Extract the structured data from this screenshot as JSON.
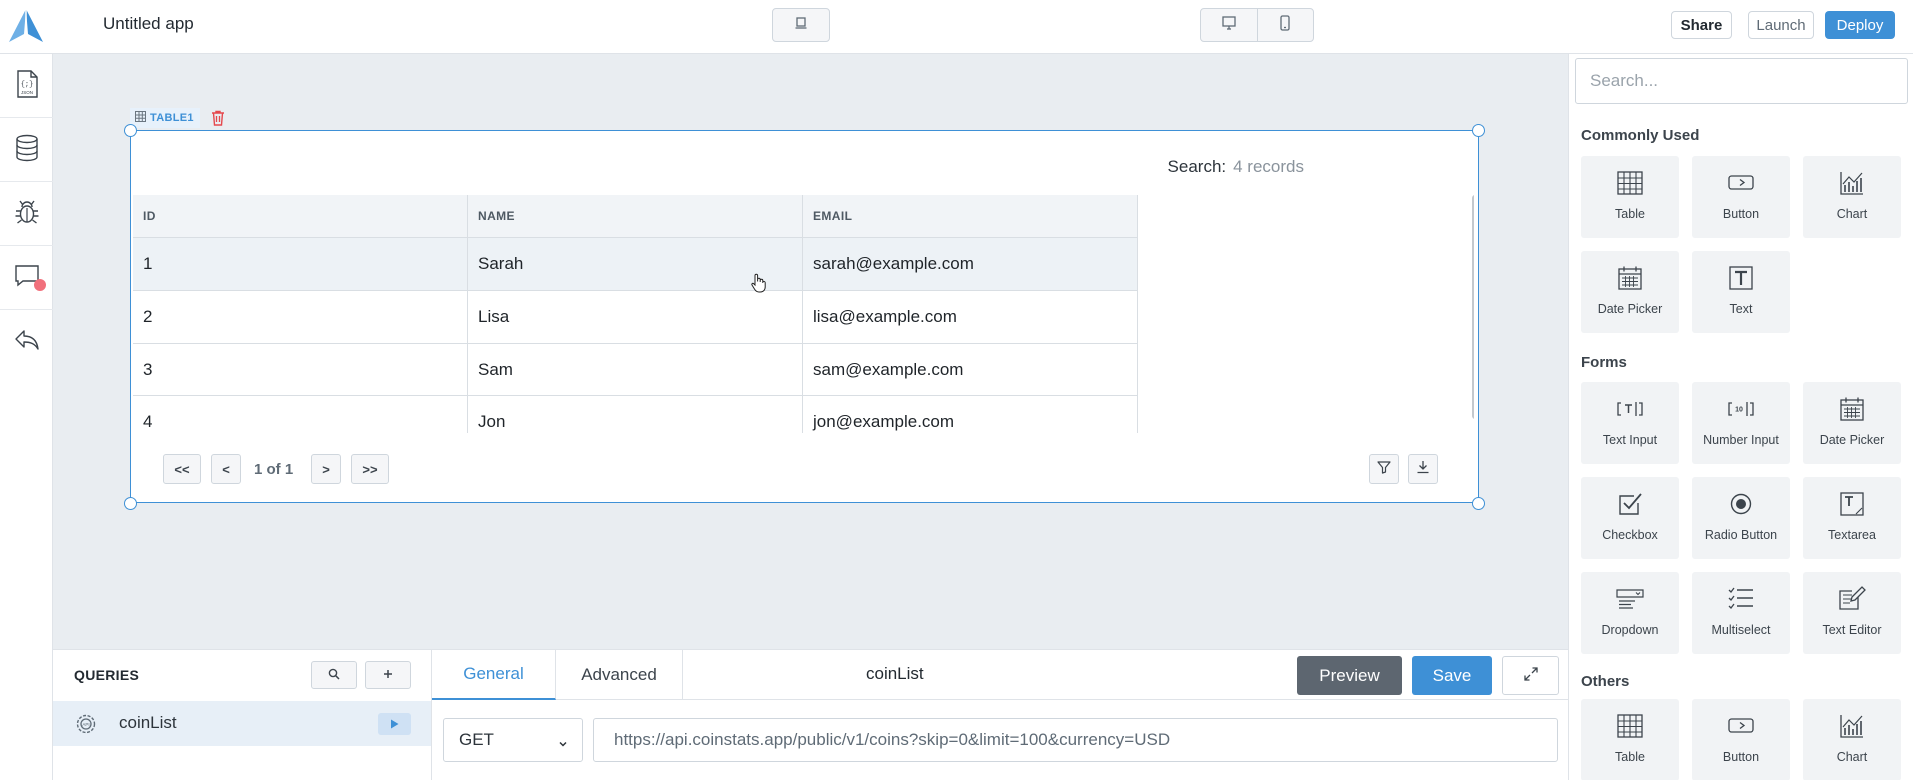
{
  "header": {
    "app_title": "Untitled app",
    "share_label": "Share",
    "launch_label": "Launch",
    "deploy_label": "Deploy"
  },
  "canvas": {
    "table_tag": "TABLE1",
    "search_label": "Search:",
    "search_value": "4 records",
    "columns": [
      "ID",
      "NAME",
      "EMAIL"
    ],
    "rows": [
      [
        "1",
        "Sarah",
        "sarah@example.com"
      ],
      [
        "2",
        "Lisa",
        "lisa@example.com"
      ],
      [
        "3",
        "Sam",
        "sam@example.com"
      ],
      [
        "4",
        "Jon",
        "jon@example.com"
      ]
    ],
    "pager": {
      "first": "<<",
      "prev": "<",
      "page_text": "1 of 1",
      "next": ">",
      "last": ">>"
    }
  },
  "queries": {
    "title": "QUERIES",
    "items": [
      {
        "label": "coinList"
      }
    ],
    "tabs": [
      "General",
      "Advanced"
    ],
    "active_tab": "General",
    "query_name": "coinList",
    "preview_label": "Preview",
    "save_label": "Save",
    "method": "GET",
    "url": "https://api.coinstats.app/public/v1/coins?skip=0&limit=100&currency=USD"
  },
  "widgets": {
    "search_placeholder": "Search...",
    "sections": [
      {
        "title": "Commonly Used",
        "items": [
          "Table",
          "Button",
          "Chart",
          "Date Picker",
          "Text"
        ]
      },
      {
        "title": "Forms",
        "items": [
          "Text Input",
          "Number Input",
          "Date Picker",
          "Checkbox",
          "Radio Button",
          "Textarea",
          "Dropdown",
          "Multiselect",
          "Text Editor"
        ]
      },
      {
        "title": "Others",
        "items": [
          "Table",
          "Button",
          "Chart"
        ]
      }
    ]
  },
  "colors": {
    "accent": "#3e90d6",
    "danger": "#e5484d",
    "canvas_bg": "#e9edf1"
  }
}
